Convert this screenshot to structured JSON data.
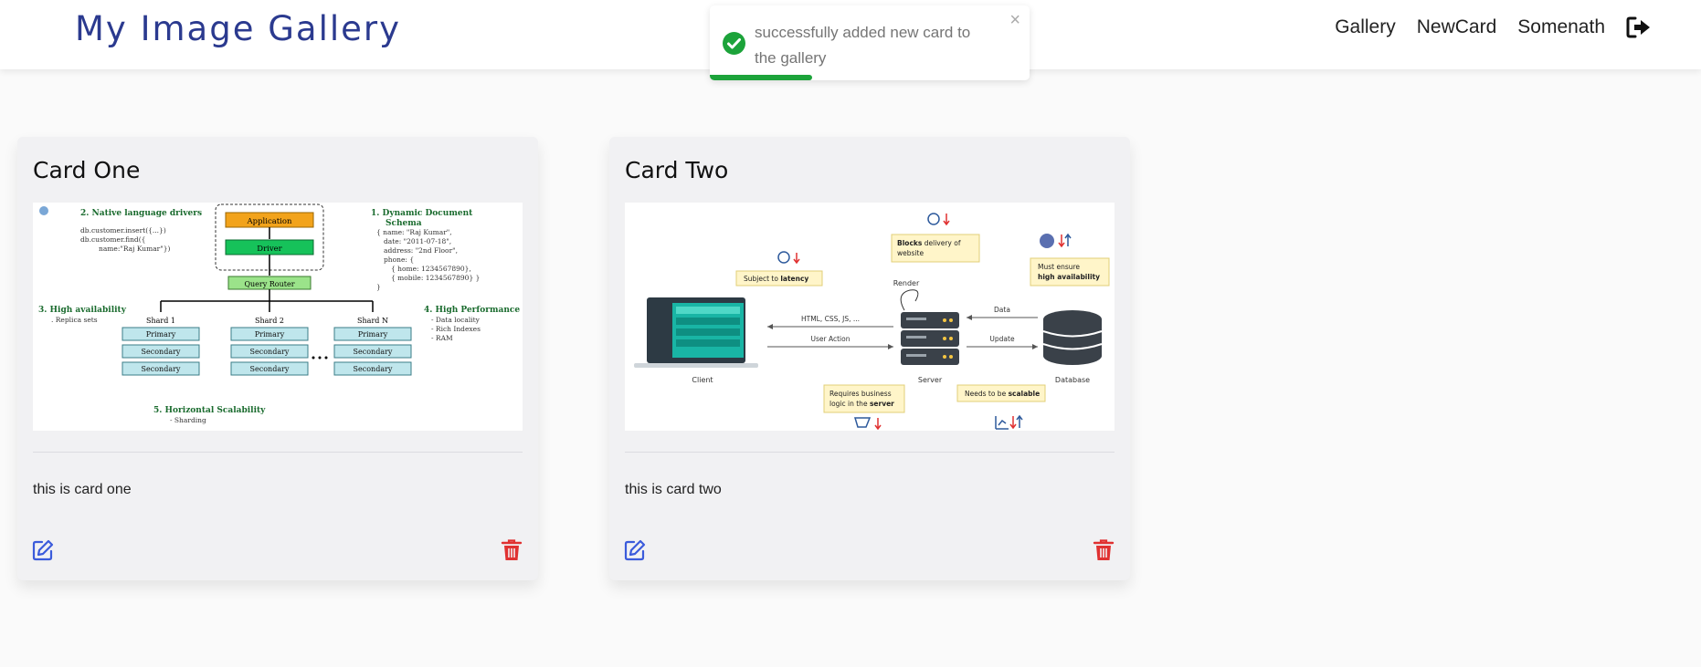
{
  "header": {
    "title": "My Image Gallery",
    "nav": {
      "gallery": "Gallery",
      "new_card": "NewCard",
      "user": "Somenath"
    },
    "logout_icon": "logout-icon"
  },
  "toast": {
    "message": "successfully added new card to the gallery",
    "close_glyph": "×",
    "type": "success",
    "progress": 0.32
  },
  "cards": [
    {
      "title": "Card One",
      "description": "this is card one",
      "diagram": {
        "native_title": "2.  Native language drivers",
        "native_code_1": "db.customer.insert({...})",
        "native_code_2": "db.customer.find({",
        "native_code_3": "name:\"Raj Kumar\"})",
        "app": "Application",
        "driver": "Driver",
        "query_router": "Query Router",
        "dyn_title_1": "1.  Dynamic Document",
        "dyn_title_2": "Schema",
        "dyn_1": "{ name: \"Raj Kumar\",",
        "dyn_2": "date: \"2011-07-18\",",
        "dyn_3": "address: \"2nd Floor\",",
        "dyn_4": "phone: {",
        "dyn_5": "{ home: 1234567890},",
        "dyn_6": "{ mobile: 1234567890} }",
        "dyn_7": "}",
        "ha_title": "3.  High  availability",
        "ha_sub": ". Replica sets",
        "hp_title": "4.  High Performance",
        "hp_1": "- Data locality",
        "hp_2": "- Rich Indexes",
        "hp_3": "- RAM",
        "shard1": "Shard 1",
        "shard2": "Shard 2",
        "shardN": "Shard N",
        "primary": "Primary",
        "secondary": "Secondary",
        "hs_title": "5.  Horizontal Scalability",
        "hs_sub": "- Sharding"
      }
    },
    {
      "title": "Card Two",
      "description": "this is card two",
      "diagram": {
        "subject": "Subject to",
        "latency": "latency",
        "blocks": "Blocks",
        "blocks_rest_1": "delivery of",
        "blocks_rest_2": "website",
        "must": "Must ensure",
        "ha": "high availability",
        "render": "Render",
        "html": "HTML, CSS, JS, ...",
        "user_action": "User Action",
        "data": "Data",
        "update": "Update",
        "client": "Client",
        "server": "Server",
        "database": "Database",
        "requires_1": "Requires business",
        "requires_2": "logic in the",
        "requires_3": "server",
        "needs": "Needs to be",
        "scalable": "scalable"
      }
    }
  ],
  "colors": {
    "brand": "#2b3a8f",
    "toast_success": "#1ca33a",
    "edit": "#3b5bdb",
    "delete": "#e03131"
  },
  "icons": {
    "edit": "edit-icon",
    "delete": "trash-icon",
    "success": "check-circle-icon"
  }
}
